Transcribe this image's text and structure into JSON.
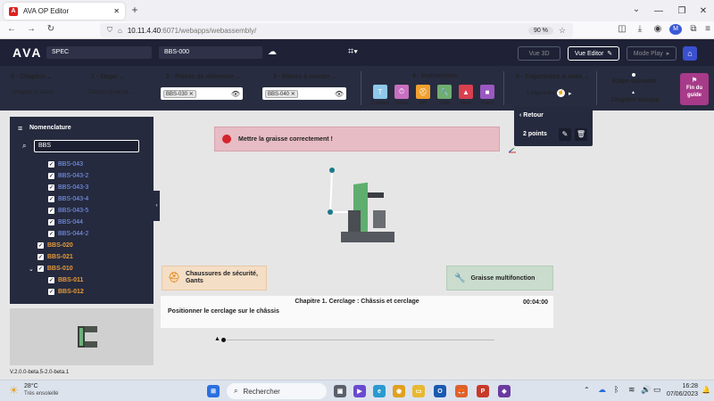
{
  "browser": {
    "tab_title": "AVA OP Editor",
    "url_host": "10.11.4.40",
    "url_rest": ":6071/webapps/webassembly/",
    "zoom": "90 %"
  },
  "header": {
    "logo": "AVA",
    "field1": "SPEC",
    "field2": "BBS-000",
    "vue3d": "Vue 3D",
    "vue_editor": "Vue Editor",
    "mode_play": "Mode Play"
  },
  "steps": {
    "chapitre_label": "0 - Chapitre",
    "chapitre_value": "Chapitre 1. Cercl...",
    "etape_label": "1 - Étape",
    "etape_value": "Châssis et cercla...",
    "ref_label": "2 - Pièces de référence",
    "ref_chip": "BBS-030",
    "monter_label": "3 - Pièces à monter",
    "monter_chip": "BBS-040",
    "instr_label": "4 - Instructions",
    "instructions": [
      {
        "label": "Consigne",
        "glyph": "T",
        "color": "#8fc8e8"
      },
      {
        "label": "Temps",
        "glyph": "⏱",
        "color": "#c770c0"
      },
      {
        "label": "EPI",
        "glyph": "⛑",
        "color": "#f0a030"
      },
      {
        "label": "Outils",
        "glyph": "🔧",
        "color": "#6fae6f"
      },
      {
        "label": "Alerte",
        "glyph": "▲",
        "color": "#d84050"
      },
      {
        "label": "Post-it",
        "glyph": "■",
        "color": "#9a58c0"
      }
    ],
    "traj_label": "5 - Trajectoires & vues",
    "traj_value": "1 trajectoire",
    "etape_suivante": "Étape suivante",
    "chapitre_suivant": "Chapitre suivant",
    "fin_du_guide": "Fin du guide"
  },
  "popup": {
    "retour": "Retour",
    "points": "2 points"
  },
  "sidebar": {
    "title": "Nomenclature",
    "search_value": "BBS",
    "items": [
      {
        "label": "BBS-043",
        "style": "blue",
        "indent": 1
      },
      {
        "label": "BBS-043-2",
        "style": "blue",
        "indent": 1
      },
      {
        "label": "BBS-043-3",
        "style": "blue",
        "indent": 1
      },
      {
        "label": "BBS-043-4",
        "style": "blue",
        "indent": 1
      },
      {
        "label": "BBS-043-5",
        "style": "blue",
        "indent": 1
      },
      {
        "label": "BBS-044",
        "style": "blue",
        "indent": 1
      },
      {
        "label": "BBS-044-2",
        "style": "blue",
        "indent": 1
      },
      {
        "label": "BBS-020",
        "style": "orange",
        "indent": 0
      },
      {
        "label": "BBS-021",
        "style": "orange",
        "indent": 0
      },
      {
        "label": "BBS-010",
        "style": "orange",
        "indent": 0,
        "expanded": true
      },
      {
        "label": "BBS-011",
        "style": "orange",
        "indent": 1
      },
      {
        "label": "BBS-012",
        "style": "orange",
        "indent": 1
      }
    ]
  },
  "viewport": {
    "alert_text": "Mettre la graisse correctement !",
    "epi_text": "Chaussures de sécurité, Gants",
    "outil_text": "Graisse multifonction",
    "chapter_title": "Chapitre 1. Cerclage : Châssis et cerclage",
    "chapter_time": "00:04:00",
    "chapter_desc": "Positionner le cerclage sur le châssis"
  },
  "version": "V.2.0.0-beta.5-2.0-beta.1",
  "taskbar": {
    "weather_temp": "28°C",
    "weather_desc": "Très ensoleillé",
    "search_placeholder": "Rechercher",
    "time": "16:28",
    "date": "07/06/2023"
  }
}
